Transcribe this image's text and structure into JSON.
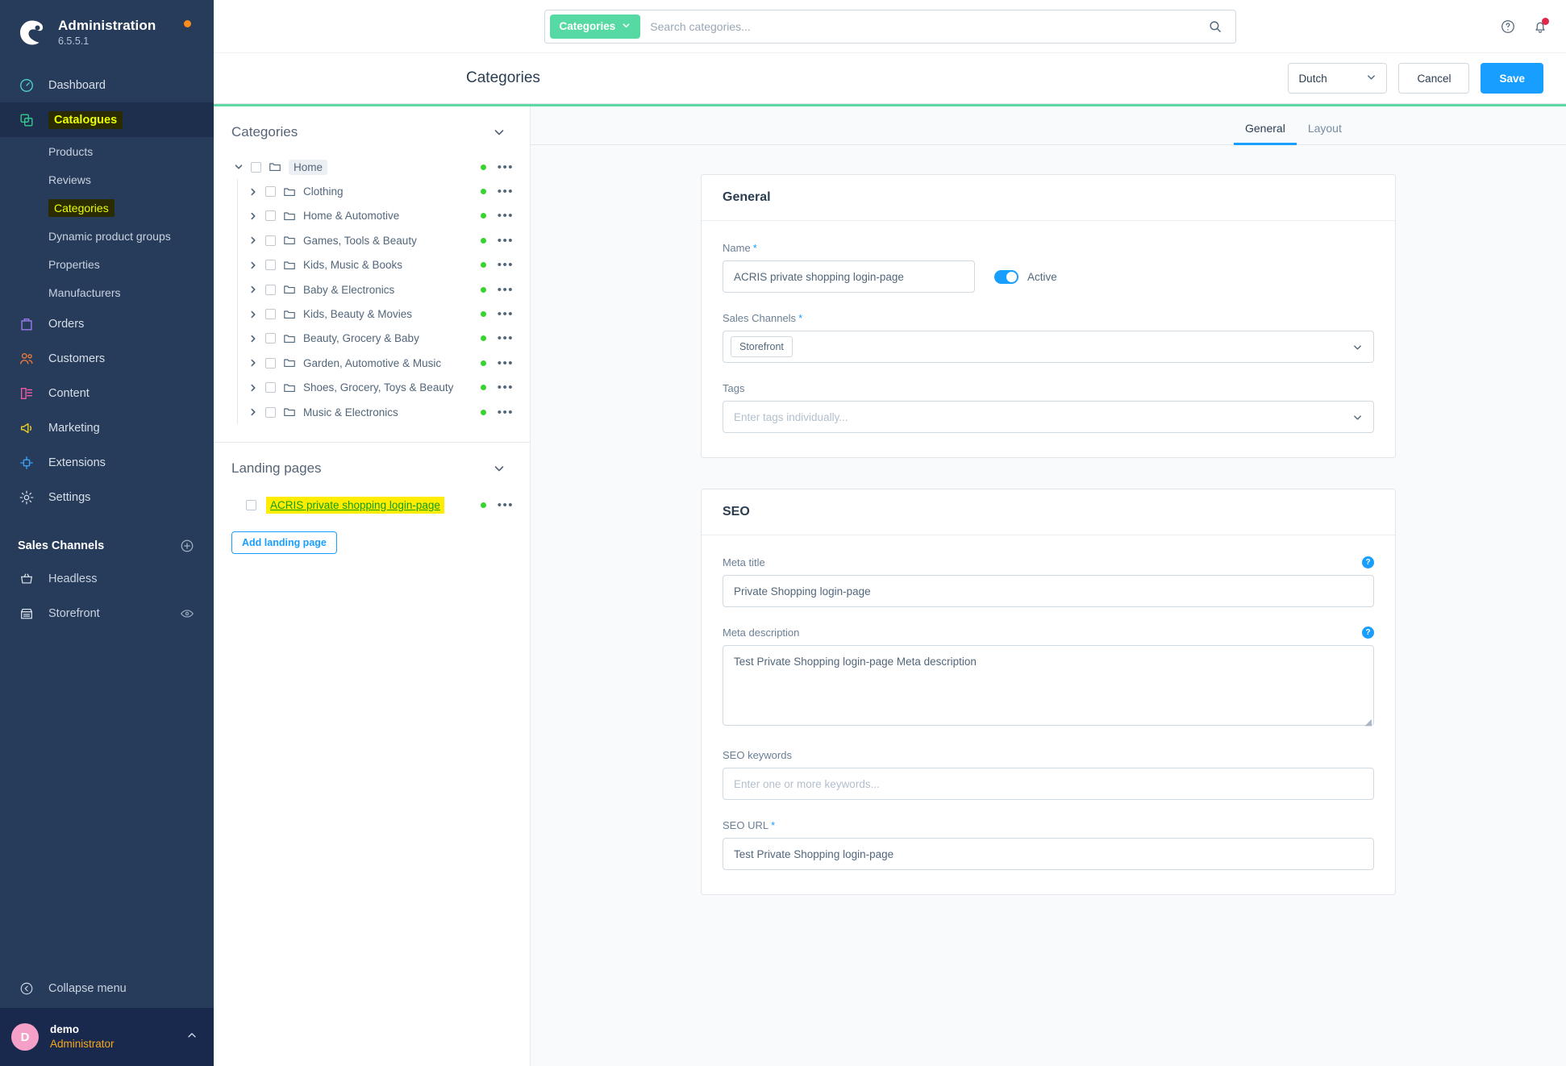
{
  "sidebar": {
    "brand": {
      "title": "Administration",
      "version": "6.5.5.1",
      "update_dot_color": "#f88c1c"
    },
    "items": [
      {
        "label": "Dashboard",
        "icon": "dashboard-icon"
      },
      {
        "label": "Catalogues",
        "icon": "catalogues-icon"
      },
      {
        "label": "Orders",
        "icon": "orders-icon"
      },
      {
        "label": "Customers",
        "icon": "customers-icon"
      },
      {
        "label": "Content",
        "icon": "content-icon"
      },
      {
        "label": "Marketing",
        "icon": "marketing-icon"
      },
      {
        "label": "Extensions",
        "icon": "extensions-icon"
      },
      {
        "label": "Settings",
        "icon": "settings-icon"
      }
    ],
    "catalogues_sub": [
      {
        "label": "Products"
      },
      {
        "label": "Reviews"
      },
      {
        "label": "Categories"
      },
      {
        "label": "Dynamic product groups"
      },
      {
        "label": "Properties"
      },
      {
        "label": "Manufacturers"
      }
    ],
    "sales_channels": {
      "title": "Sales Channels",
      "add_icon": "plus-circle-icon",
      "channels": [
        {
          "label": "Headless",
          "icon": "basket-icon"
        },
        {
          "label": "Storefront",
          "icon": "storefront-icon",
          "eye_icon": "eye-icon"
        }
      ]
    },
    "collapse": {
      "label": "Collapse menu",
      "icon": "chevron-left-circle-icon"
    },
    "user": {
      "initial": "D",
      "name": "demo",
      "role": "Administrator",
      "caret_icon": "chevron-up-icon"
    }
  },
  "topbar": {
    "search_scope": "Categories",
    "search_placeholder": "Search categories...",
    "search_value": "",
    "search_icon": "search-icon",
    "help_icon": "help-circle-icon",
    "notification_icon": "bell-icon",
    "notification_badge_color": "#de294c"
  },
  "pagehead": {
    "title": "Categories",
    "language": "Dutch",
    "cancel_label": "Cancel",
    "save_label": "Save"
  },
  "tree_panel": {
    "categories": {
      "section_title": "Categories",
      "root": {
        "label": "Home",
        "selected": true,
        "expanded": true,
        "status": "active"
      },
      "children": [
        {
          "label": "Clothing"
        },
        {
          "label": "Home & Automotive"
        },
        {
          "label": "Games, Tools & Beauty"
        },
        {
          "label": "Kids, Music & Books"
        },
        {
          "label": "Baby & Electronics"
        },
        {
          "label": "Kids, Beauty & Movies"
        },
        {
          "label": "Beauty, Grocery & Baby"
        },
        {
          "label": "Garden, Automotive & Music"
        },
        {
          "label": "Shoes, Grocery, Toys & Beauty"
        },
        {
          "label": "Music & Electronics"
        }
      ]
    },
    "landing_pages": {
      "section_title": "Landing pages",
      "items": [
        {
          "label": "ACRIS private shopping login-page",
          "highlighted": true
        }
      ],
      "add_button": "Add landing page"
    },
    "status_dot_color": "#37d430",
    "highlight_color": "#ffec00",
    "highlight_text_color": "#0f9d14"
  },
  "content": {
    "tabs": [
      {
        "label": "General",
        "active": true
      },
      {
        "label": "Layout",
        "active": false
      }
    ],
    "general_card": {
      "title": "General",
      "name_label": "Name",
      "name_value": "ACRIS private shopping login-page",
      "active_label": "Active",
      "active_on": true,
      "sales_channels_label": "Sales Channels",
      "sales_channels_chips": [
        "Storefront"
      ],
      "tags_label": "Tags",
      "tags_placeholder": "Enter tags individually...",
      "tags_value": ""
    },
    "seo_card": {
      "title": "SEO",
      "meta_title_label": "Meta title",
      "meta_title_value": "Private Shopping login-page",
      "meta_description_label": "Meta description",
      "meta_description_value": "Test Private Shopping login-page Meta description",
      "seo_keywords_label": "SEO keywords",
      "seo_keywords_placeholder": "Enter one or more keywords...",
      "seo_keywords_value": "",
      "seo_url_label": "SEO URL",
      "seo_url_value": "Test Private Shopping login-page",
      "help_badge": "?"
    }
  }
}
